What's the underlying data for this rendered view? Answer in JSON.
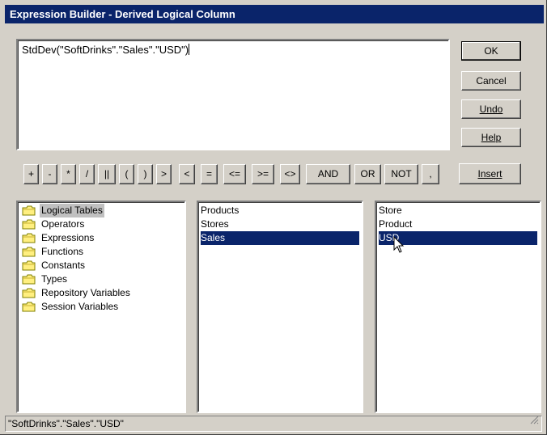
{
  "window": {
    "title": "Expression Builder - Derived Logical Column"
  },
  "expression": {
    "value": "StdDev(\"SoftDrinks\".\"Sales\".\"USD\")"
  },
  "buttons": {
    "ok": "OK",
    "cancel": "Cancel",
    "undo": "Undo",
    "help": "Help",
    "insert": "Insert"
  },
  "operators": [
    "+",
    "-",
    "*",
    "/",
    "||",
    "(",
    ")",
    ">",
    "<",
    "=",
    "<=",
    ">=",
    "<>",
    "AND",
    "OR",
    "NOT",
    ","
  ],
  "categories": [
    "Logical Tables",
    "Operators",
    "Expressions",
    "Functions",
    "Constants",
    "Types",
    "Repository Variables",
    "Session Variables"
  ],
  "tables": [
    "Products",
    "Stores",
    "Sales"
  ],
  "columns": [
    "Store",
    "Product",
    "USD"
  ],
  "status": {
    "text": "\"SoftDrinks\".\"Sales\".\"USD\""
  },
  "colors": {
    "titlebar": "#0a246a",
    "selection": "#0a246a",
    "face": "#d4d0c8"
  },
  "icons": {
    "folder": "folder-icon",
    "cursor": "mouse-pointer-icon",
    "grip": "resize-grip-icon"
  }
}
